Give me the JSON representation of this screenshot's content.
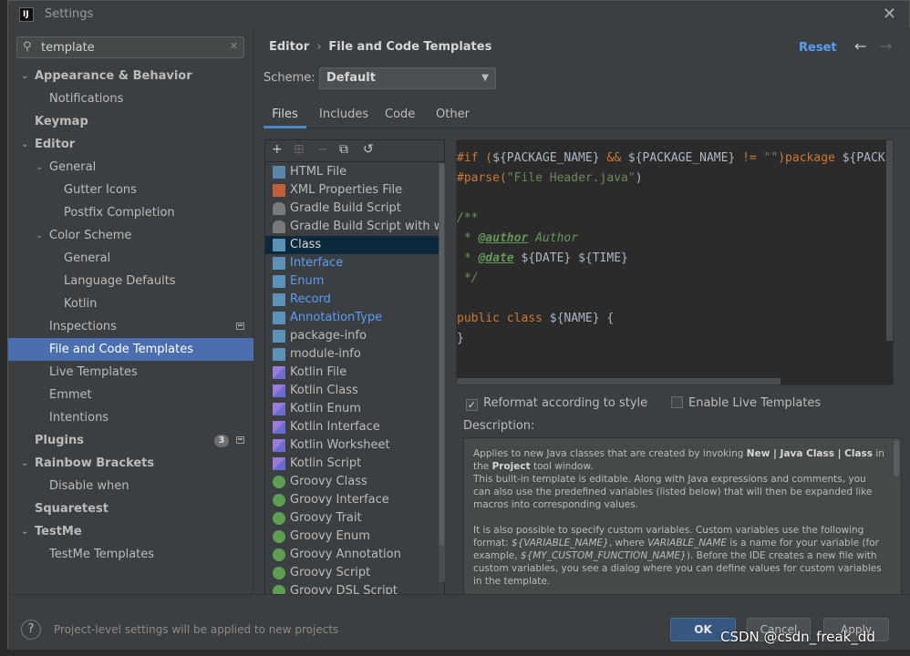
{
  "window": {
    "title": "Settings",
    "app_icon": "IJ"
  },
  "search": {
    "value": "template"
  },
  "sidebar": {
    "items": [
      {
        "label": "Appearance & Behavior",
        "level": 0,
        "bold": true,
        "chevron": "down"
      },
      {
        "label": "Notifications",
        "level": 1
      },
      {
        "label": "Keymap",
        "level": 0,
        "bold": true
      },
      {
        "label": "Editor",
        "level": 0,
        "bold": true,
        "chevron": "down"
      },
      {
        "label": "General",
        "level": 1,
        "chevron": "down"
      },
      {
        "label": "Gutter Icons",
        "level": 2
      },
      {
        "label": "Postfix Completion",
        "level": 2
      },
      {
        "label": "Color Scheme",
        "level": 1,
        "chevron": "down"
      },
      {
        "label": "General",
        "level": 2
      },
      {
        "label": "Language Defaults",
        "level": 2
      },
      {
        "label": "Kotlin",
        "level": 2
      },
      {
        "label": "Inspections",
        "level": 1,
        "project": true
      },
      {
        "label": "File and Code Templates",
        "level": 1,
        "selected": true
      },
      {
        "label": "Live Templates",
        "level": 1
      },
      {
        "label": "Emmet",
        "level": 1
      },
      {
        "label": "Intentions",
        "level": 1
      },
      {
        "label": "Plugins",
        "level": 0,
        "bold": true,
        "badge": "3",
        "project": true
      },
      {
        "label": "Rainbow Brackets",
        "level": 0,
        "bold": true,
        "chevron": "down"
      },
      {
        "label": "Disable when",
        "level": 1
      },
      {
        "label": "Squaretest",
        "level": 0,
        "bold": true
      },
      {
        "label": "TestMe",
        "level": 0,
        "bold": true,
        "chevron": "down"
      },
      {
        "label": "TestMe Templates",
        "level": 1
      }
    ]
  },
  "header": {
    "crumb_parent": "Editor",
    "crumb_sep": "›",
    "crumb_current": "File and Code Templates",
    "reset": "Reset",
    "back_arrow": "←",
    "forward_arrow": "→"
  },
  "scheme": {
    "label": "Scheme:",
    "value": "Default"
  },
  "tabs": [
    "Files",
    "Includes",
    "Code",
    "Other"
  ],
  "toolbar": {
    "add": "+",
    "copy": "⧉",
    "revert": "↺"
  },
  "templates": [
    {
      "name": "HTML File",
      "icon": "html"
    },
    {
      "name": "XML Properties File",
      "icon": "xml"
    },
    {
      "name": "Gradle Build Script",
      "icon": "gradle"
    },
    {
      "name": "Gradle Build Script with wrapp",
      "icon": "gradle"
    },
    {
      "name": "Class",
      "icon": "java",
      "selected": true
    },
    {
      "name": "Interface",
      "icon": "java",
      "modified": true
    },
    {
      "name": "Enum",
      "icon": "java",
      "modified": true
    },
    {
      "name": "Record",
      "icon": "java",
      "modified": true
    },
    {
      "name": "AnnotationType",
      "icon": "java",
      "modified": true
    },
    {
      "name": "package-info",
      "icon": "java"
    },
    {
      "name": "module-info",
      "icon": "java"
    },
    {
      "name": "Kotlin File",
      "icon": "kotlin"
    },
    {
      "name": "Kotlin Class",
      "icon": "kotlin"
    },
    {
      "name": "Kotlin Enum",
      "icon": "kotlin"
    },
    {
      "name": "Kotlin Interface",
      "icon": "kotlin"
    },
    {
      "name": "Kotlin Worksheet",
      "icon": "kotlin"
    },
    {
      "name": "Kotlin Script",
      "icon": "kotlin"
    },
    {
      "name": "Groovy Class",
      "icon": "groovy"
    },
    {
      "name": "Groovy Interface",
      "icon": "groovy"
    },
    {
      "name": "Groovy Trait",
      "icon": "groovy"
    },
    {
      "name": "Groovy Enum",
      "icon": "groovy"
    },
    {
      "name": "Groovy Annotation",
      "icon": "groovy"
    },
    {
      "name": "Groovy Script",
      "icon": "groovy"
    },
    {
      "name": "Groovy DSL Script",
      "icon": "groovy"
    }
  ],
  "code": {
    "line1": [
      {
        "t": "#if (",
        "c": "c-dir"
      },
      {
        "t": "${PACKAGE_NAME}",
        "c": "c-plain"
      },
      {
        "t": " && ",
        "c": "c-dir"
      },
      {
        "t": "${PACKAGE_NAME}",
        "c": "c-plain"
      },
      {
        "t": " != ",
        "c": "c-dir"
      },
      {
        "t": "\"\"",
        "c": "c-str"
      },
      {
        "t": ")package ",
        "c": "c-dir"
      },
      {
        "t": "${PACK",
        "c": "c-plain"
      }
    ],
    "line2": [
      {
        "t": "#parse(",
        "c": "c-dir"
      },
      {
        "t": "\"File Header.java\"",
        "c": "c-str"
      },
      {
        "t": ")",
        "c": "c-plain"
      }
    ],
    "line4": [
      {
        "t": "/**",
        "c": "c-com"
      }
    ],
    "line5": [
      {
        "t": " * ",
        "c": "c-com"
      },
      {
        "t": "@author",
        "c": "c-tag"
      },
      {
        "t": " Author",
        "c": "c-com"
      }
    ],
    "line6": [
      {
        "t": " * ",
        "c": "c-com"
      },
      {
        "t": "@date",
        "c": "c-tag"
      },
      {
        "t": " ${DATE} ${TIME}",
        "c": "c-plain"
      }
    ],
    "line7": [
      {
        "t": " */",
        "c": "c-com"
      }
    ],
    "line9": [
      {
        "t": "public class ",
        "c": "c-kw"
      },
      {
        "t": "${NAME} {",
        "c": "c-plain"
      }
    ],
    "line10": [
      {
        "t": "}",
        "c": "c-plain"
      }
    ]
  },
  "options": {
    "reformat": {
      "label": "Reformat according to style",
      "checked": true
    },
    "live_templates": {
      "label": "Enable Live Templates",
      "checked": false
    }
  },
  "description": {
    "label": "Description:",
    "p1_a": "Applies to new Java classes that are created by invoking ",
    "p1_b": "New | Java Class | Class",
    "p1_c": " in the ",
    "p1_d": "Project",
    "p1_e": " tool window.",
    "p2": "This built-in template is editable. Along with Java expressions and comments, you can also use the predefined variables (listed below) that will then be expanded like macros into corresponding values.",
    "p3_a": "It is also possible to specify custom variables. Custom variables use the following format: ",
    "p3_b": "${VARIABLE_NAME}",
    "p3_c": ", where ",
    "p3_d": "VARIABLE_NAME",
    "p3_e": " is a name for your variable (for example, ",
    "p3_f": "${MY_CUSTOM_FUNCTION_NAME}",
    "p3_g": "). Before the IDE creates a new file with custom variables, you see a dialog where you can define values for custom variables in the template."
  },
  "footer": {
    "help": "?",
    "note": "Project-level settings will be applied to new projects",
    "ok": "OK",
    "cancel": "Cancel",
    "apply": "Apply"
  },
  "watermark": "CSDN @csdn_freak_dd",
  "colors": {
    "accent": "#4b6eaf",
    "link": "#589df6",
    "ok_button": "#365880"
  }
}
